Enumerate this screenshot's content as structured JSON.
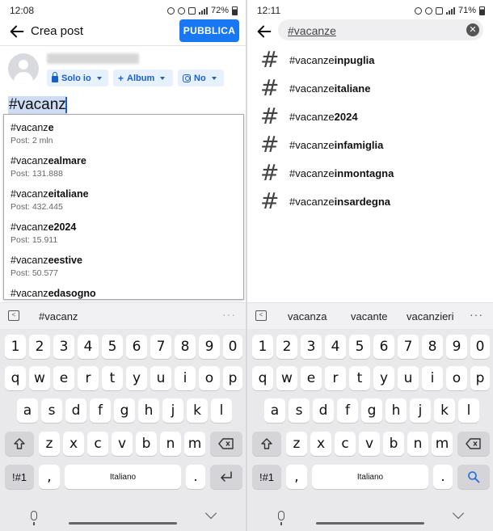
{
  "left": {
    "status": {
      "time": "12:08",
      "battery": "72%"
    },
    "header": {
      "title": "Crea post",
      "publish_label": "PUBBLICA"
    },
    "chips": {
      "privacy": "Solo io",
      "album": "Album",
      "instagram": "No"
    },
    "compose_text": "#vacanz",
    "suggestions": [
      {
        "prefix": "#vacanz",
        "suffix": "e",
        "count": "Post: 2 mln"
      },
      {
        "prefix": "#vacanz",
        "suffix": "ealmare",
        "count": "Post: 131.888"
      },
      {
        "prefix": "#vacanz",
        "suffix": "eitaliane",
        "count": "Post: 432.445"
      },
      {
        "prefix": "#vacanz",
        "suffix": "e2024",
        "count": "Post: 15.911"
      },
      {
        "prefix": "#vacanz",
        "suffix": "eestive",
        "count": "Post: 50.577"
      },
      {
        "prefix": "#vacanz",
        "suffix": "edasogno",
        "count": ""
      }
    ],
    "keyboard_suggestion": "#vacanz"
  },
  "right": {
    "status": {
      "time": "12:11",
      "battery": "71%"
    },
    "search_text": "#vacanze",
    "results": [
      {
        "prefix": "#vacanze",
        "suffix": "inpuglia"
      },
      {
        "prefix": "#vacanze",
        "suffix": "italiane"
      },
      {
        "prefix": "#vacanze",
        "suffix": "2024"
      },
      {
        "prefix": "#vacanze",
        "suffix": "infamiglia"
      },
      {
        "prefix": "#vacanze",
        "suffix": "inmontagna"
      },
      {
        "prefix": "#vacanze",
        "suffix": "insardegna"
      }
    ],
    "keyboard_suggestions": [
      "vacanza",
      "vacante",
      "vacanzieri"
    ]
  },
  "keyboard": {
    "numbers": [
      "1",
      "2",
      "3",
      "4",
      "5",
      "6",
      "7",
      "8",
      "9",
      "0"
    ],
    "row1": [
      "q",
      "w",
      "e",
      "r",
      "t",
      "y",
      "u",
      "i",
      "o",
      "p"
    ],
    "row2": [
      "a",
      "s",
      "d",
      "f",
      "g",
      "h",
      "j",
      "k",
      "l"
    ],
    "row3": [
      "z",
      "x",
      "c",
      "v",
      "b",
      "n",
      "m"
    ],
    "symbols_label": "!#1",
    "comma": ",",
    "space_label": "Italiano",
    "period": ".",
    "dots": "···"
  }
}
